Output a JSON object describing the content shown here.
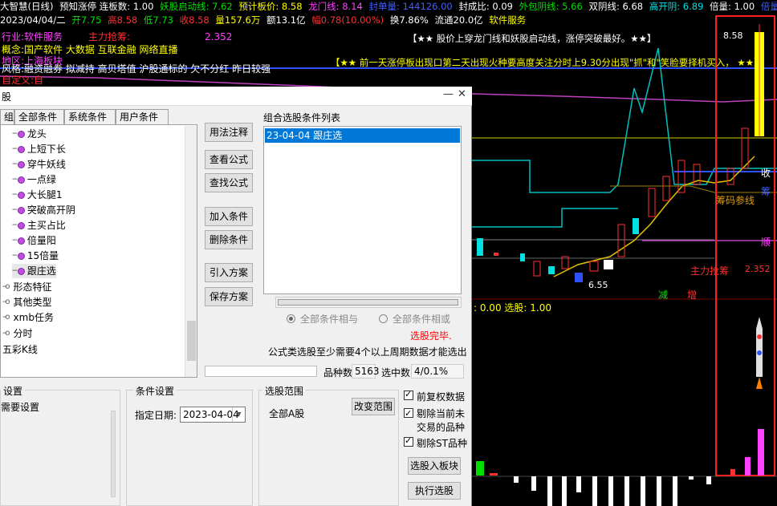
{
  "top_bar": {
    "app": "大智慧(日线)",
    "s1": "预知涨停 连板数: 1.00",
    "s2": "妖股启动线: 7.62",
    "s3": "预计板价: 8.58",
    "s4": "龙门线: 8.14",
    "s5": "封单量: 144126.00",
    "s6": "封成比: 0.09",
    "s7": "外包阴线: 5.66",
    "s8": "双阴线: 6.68",
    "s9": "高开阴: 6.89",
    "s10": "倍量: 1.00",
    "s11": "倍量日: 7.44"
  },
  "quote_bar": {
    "date": "2023/04/04/二",
    "open": "开7.75",
    "high": "高8.58",
    "low": "低7.73",
    "close": "收8.58",
    "volume": "量157.6万",
    "amount": "额13.1亿",
    "change": "幅0.78(10.00%)",
    "turnover": "换7.86%",
    "float": "流通20.0亿",
    "sector": "软件服务"
  },
  "info": {
    "industry": "行业:软件服务",
    "main_force": "主力抢筹:",
    "main_value": "2.352",
    "concept": "概念:国产软件 大数据 互联金融 网络直播",
    "region": "地区:上海板块",
    "style": "风格:融资融券 拟减持 高贝塔值 沪股通标的 欠不分红 昨日较强",
    "custom": "自定义:自",
    "banner1": "【★★ 股价上穿龙门线和妖股启动线，涨停突破最好。★★】",
    "banner2": "【★★ 前一天涨停板出现口第二天出现火种要高度关注分时上9.30分出现\"抓\"和\"笑脸要择机买入，   ★★】"
  },
  "chart": {
    "price_high_label": "8.58",
    "price_low_label": "6.55",
    "right_labels": [
      "收",
      "筹",
      "筹码参线",
      "顺"
    ],
    "main_force_label": "主力抢筹",
    "main_force_value": "2.352",
    "markers": [
      "减",
      "增"
    ],
    "sub_header": ": 0.00  选股: 1.00"
  },
  "dialog": {
    "title": "股",
    "close_icon": "close-icon",
    "tabs": [
      "组",
      "全部条件",
      "系统条件",
      "用户条件"
    ],
    "tree_items": [
      "龙头",
      "上短下长",
      "穿牛妖线",
      "一点绿",
      "大长腿1",
      "突破高开阴",
      "主买占比",
      "倍量阳",
      "15倍量",
      "跟庄选"
    ],
    "tree_groups": [
      "形态特征",
      "其他类型",
      "xmb任务",
      "分时"
    ],
    "tree_root": "五彩K线",
    "buttons": {
      "usage": "用法注释",
      "view_formula": "查看公式",
      "find_formula": "查找公式",
      "add_condition": "加入条件",
      "delete_condition": "删除条件",
      "import_plan": "引入方案",
      "save_plan": "保存方案"
    },
    "list_title": "组合选股条件列表",
    "list_items": [
      "23-04-04 跟庄选"
    ],
    "radio_and": "全部条件相与",
    "radio_or": "全部条件相或",
    "status": "选股完毕.",
    "note": "公式类选股至少需要4个以上周期数据才能选出",
    "count_label": "品种数",
    "count_value": "5163",
    "selected_label": "选中数",
    "selected_value": "4/0.1%",
    "settings_title": "设置",
    "settings_note": "需要设置",
    "cond_title": "条件设置",
    "date_label": "指定日期:",
    "date_value": "2023-04-04",
    "range_title": "选股范围",
    "range_value": "全部A股",
    "change_range": "改变范围",
    "chk1": "前复权数据",
    "chk2": "剔除当前未交易的品种",
    "chk3": "剔除ST品种",
    "to_block": "选股入板块",
    "execute": "执行选股"
  },
  "colors": {
    "accent_red": "#ff0000",
    "bull_red": "#ff3030",
    "bear_cyan": "#00e0e0",
    "selection_blue": "#0078d7"
  }
}
